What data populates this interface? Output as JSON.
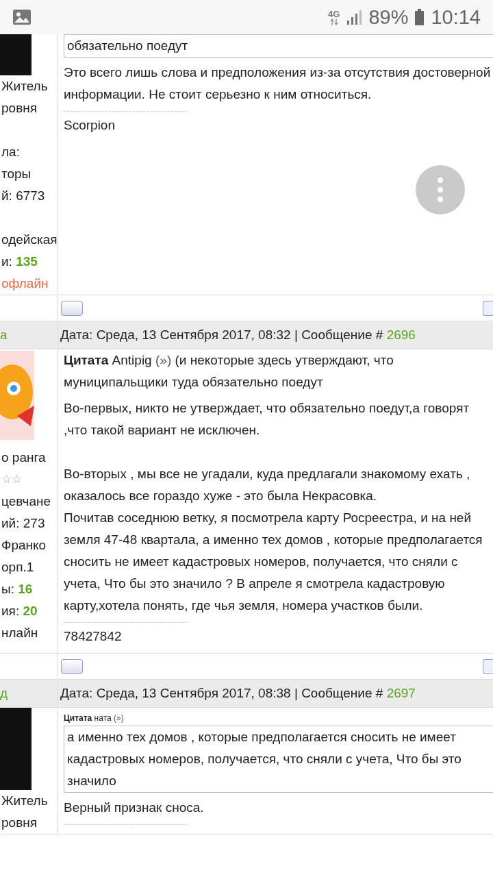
{
  "status_bar": {
    "network": "4G",
    "battery": "89%",
    "time": "10:14"
  },
  "posts": [
    {
      "avatar": {
        "kind": "dark_cropped"
      },
      "profile": [
        {
          "kind": "text",
          "text": "Житель"
        },
        {
          "kind": "text",
          "text": "ровня"
        },
        {
          "kind": "blank"
        },
        {
          "kind": "text",
          "text": "ла:"
        },
        {
          "kind": "text",
          "text": "торы"
        },
        {
          "kind": "text",
          "text": "й: 6773"
        },
        {
          "kind": "blank"
        },
        {
          "kind": "text",
          "text": "одейская"
        },
        {
          "kind": "count",
          "text": "и: ",
          "value": "135"
        },
        {
          "kind": "offline",
          "text": "офлайн"
        }
      ],
      "quote": {
        "kind": "boxed",
        "lines": [
          "обязательно поедут"
        ]
      },
      "paragraphs": [
        [
          "Это всего лишь слова и предположения из-за отсутствия достоверной информации. Не стоит серьезно к ним относиться."
        ]
      ],
      "signature": "Scorpion"
    },
    {
      "header": {
        "author": "а",
        "date": "Дата: Среда, 13 Сентября 2017, 08:32 | Сообщение # ",
        "number": "2696"
      },
      "avatar": {
        "kind": "cat"
      },
      "profile": [
        {
          "kind": "text",
          "text": "о ранга"
        },
        {
          "kind": "stars",
          "text": "☆☆"
        },
        {
          "kind": "text",
          "text": "цевчане"
        },
        {
          "kind": "text",
          "text": "ий: 273"
        },
        {
          "kind": "text",
          "text": "Франко"
        },
        {
          "kind": "text",
          "text": "орп.1"
        },
        {
          "kind": "count",
          "text": "ы: ",
          "value": "16"
        },
        {
          "kind": "count",
          "text": "ия: ",
          "value": "20"
        },
        {
          "kind": "online",
          "text": "нлайн"
        }
      ],
      "quote": {
        "kind": "inline",
        "label": "Цитата",
        "author": "Antipig",
        "link": "(»)",
        "lines": [
          "(и некоторые здесь утверждают, что муниципальщики туда обязательно поедут"
        ]
      },
      "paragraphs": [
        [
          "Во-первых, никто не утверждает, что обязательно поедут,а говорят ,что такой вариант не исключен."
        ],
        [
          "Во-вторых , мы все не угадали, куда предлагали знакомому ехать , оказалось все гораздо хуже - это была Некрасовка.",
          "Почитав соседнюю ветку, я посмотрела карту Росреестра, и на ней земля 47-48 квартала, а именно тех домов , которые предполагается сносить не имеет кадастровых номеров, получается, что сняли с учета, Что бы это значило ? В апреле я смотрела кадастровую карту,хотела понять, где чья земля, номера участков были."
        ]
      ],
      "signature": "78427842"
    },
    {
      "header": {
        "author": "д",
        "date": "Дата: Среда, 13 Сентября 2017, 08:38 | Сообщение # ",
        "number": "2697"
      },
      "avatar": {
        "kind": "dark"
      },
      "profile": [
        {
          "kind": "text",
          "text": "Житель"
        },
        {
          "kind": "text",
          "text": "ровня"
        }
      ],
      "quote": {
        "kind": "boxed",
        "label": "Цитата",
        "author": "ната",
        "link": "(»)",
        "lines": [
          "а именно тех домов , которые предполагается сносить не имеет кадастровых номеров, получается, что сняли с учета, Что бы это значило"
        ]
      },
      "paragraphs": [
        [
          "Верный признак сноса."
        ]
      ]
    }
  ]
}
